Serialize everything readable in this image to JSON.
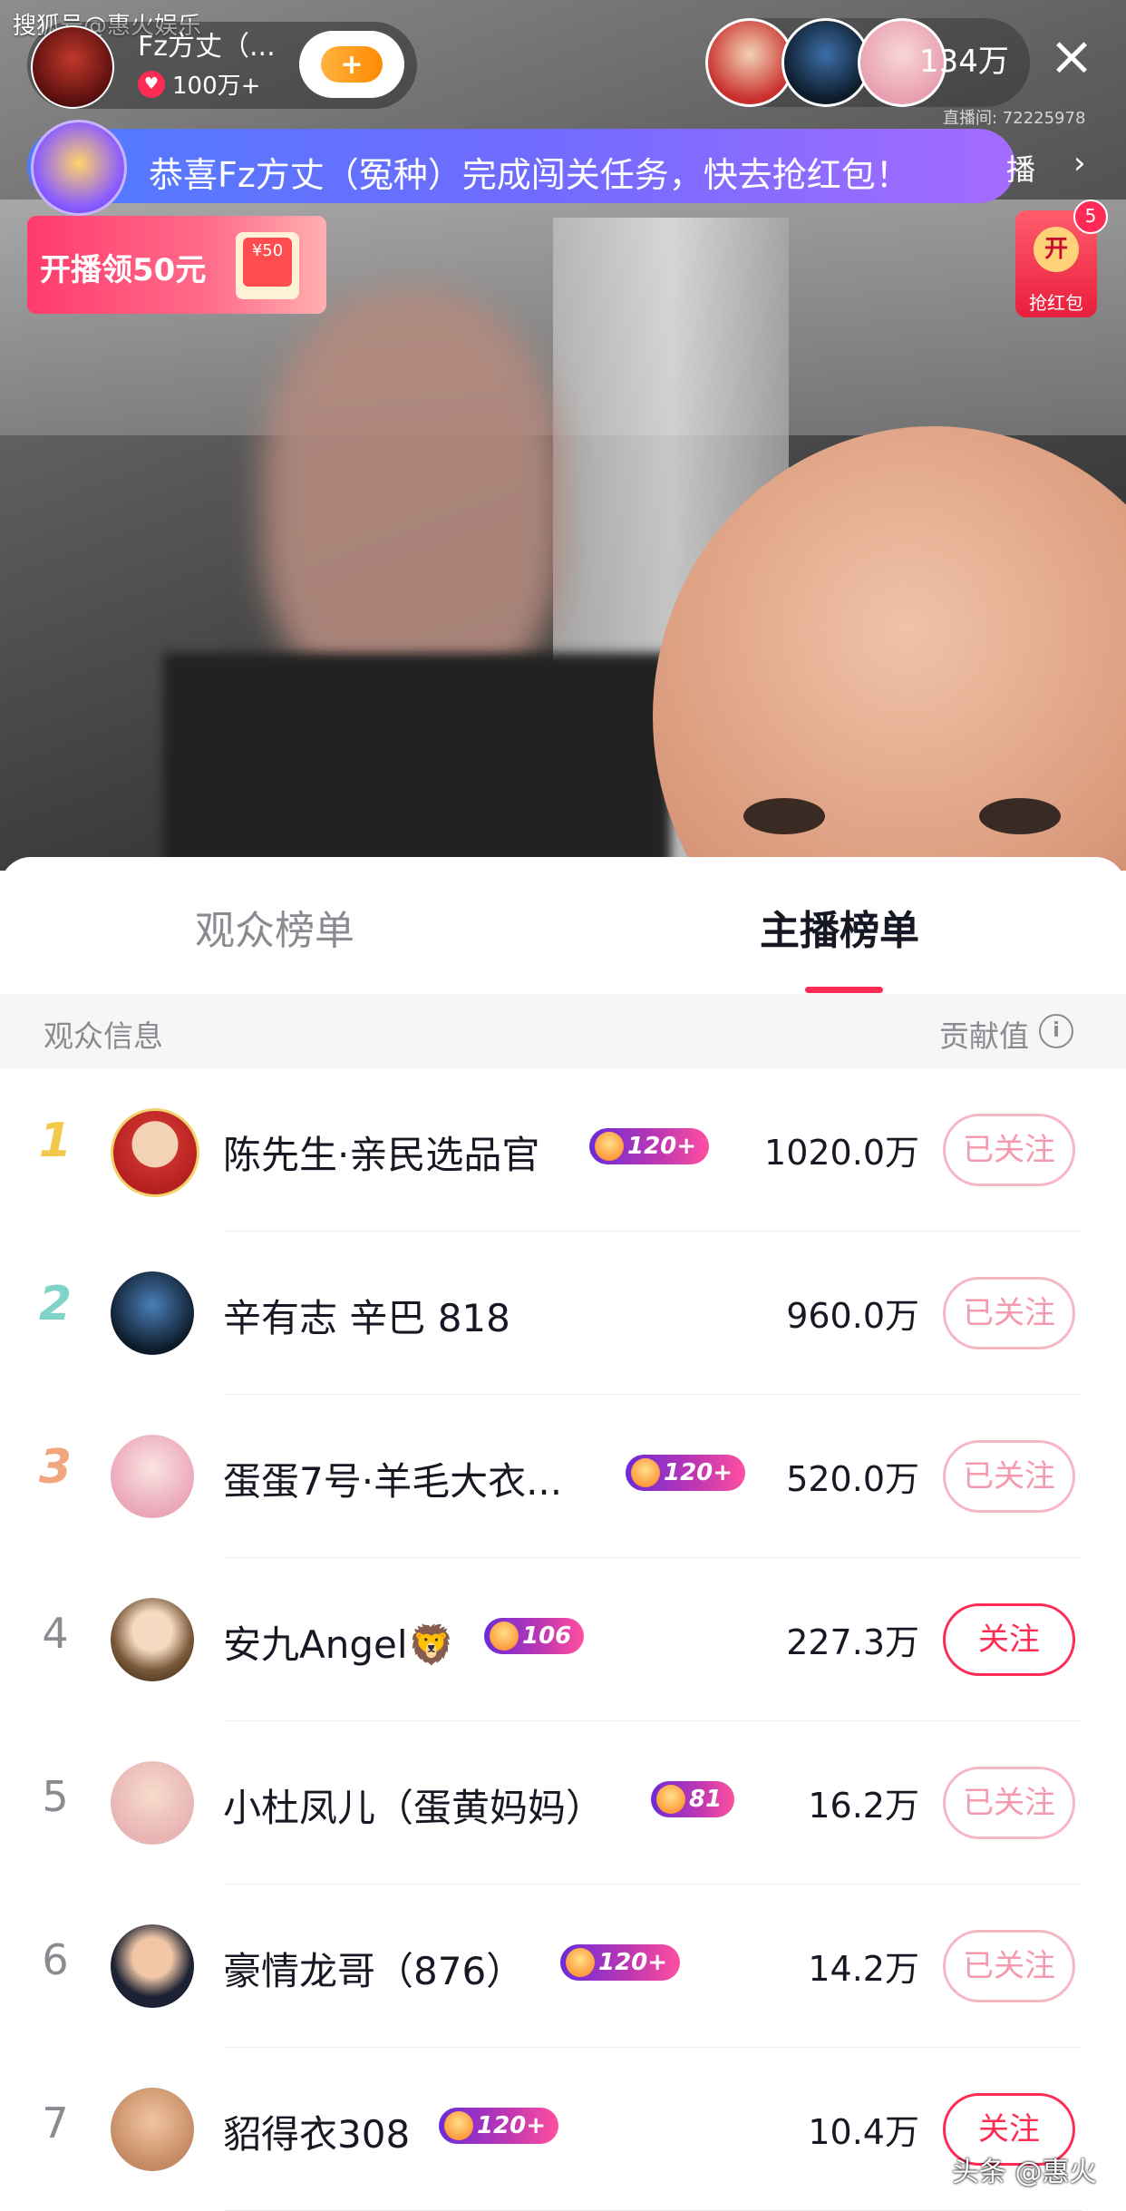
{
  "watermark_top": "搜狐号@惠火娱乐",
  "anchor": {
    "name": "Fz方丈（...",
    "likes": "100万+"
  },
  "viewers": {
    "count": "134万",
    "room_id": "直播间: 72225978"
  },
  "banner": {
    "text": "恭喜Fz方丈（冤种）完成闯关任务，快去抢红包！",
    "tail": "播"
  },
  "promo": {
    "text": "开播领50元",
    "envelope": "¥50"
  },
  "red_packet": {
    "badge": "5",
    "open": "开",
    "label": "抢红包"
  },
  "tabs": {
    "audience": "观众榜单",
    "anchor": "主播榜单",
    "active": "anchor"
  },
  "list_header": {
    "left": "观众信息",
    "right": "贡献值",
    "info_icon": "i"
  },
  "colors": {
    "accent": "#fe2c55",
    "rank1": "#f2c94c",
    "rank2": "#7fd3c8",
    "rank3": "#f0a67e",
    "rank_plain": "#8a8b91"
  },
  "rows": [
    {
      "rank": "1",
      "name": "陈先生·亲民选品官",
      "level": "120+",
      "score": "1020.0万",
      "follow": "已关注",
      "followed": true
    },
    {
      "rank": "2",
      "name": "辛有志 辛巴 818",
      "level": "",
      "score": "960.0万",
      "follow": "已关注",
      "followed": true
    },
    {
      "rank": "3",
      "name": "蛋蛋7号·羊毛大衣...",
      "level": "120+",
      "score": "520.0万",
      "follow": "已关注",
      "followed": true
    },
    {
      "rank": "4",
      "name": "安九Angel🦁",
      "level": "106",
      "score": "227.3万",
      "follow": "关注",
      "followed": false
    },
    {
      "rank": "5",
      "name": "小杜凤儿（蛋黄妈妈）",
      "level": "81",
      "score": "16.2万",
      "follow": "已关注",
      "followed": true
    },
    {
      "rank": "6",
      "name": "豪情龙哥（876）",
      "level": "120+",
      "score": "14.2万",
      "follow": "已关注",
      "followed": true
    },
    {
      "rank": "7",
      "name": "貂得衣308",
      "level": "120+",
      "score": "10.4万",
      "follow": "关注",
      "followed": false
    }
  ],
  "watermark_bottom": "头条 @惠火"
}
